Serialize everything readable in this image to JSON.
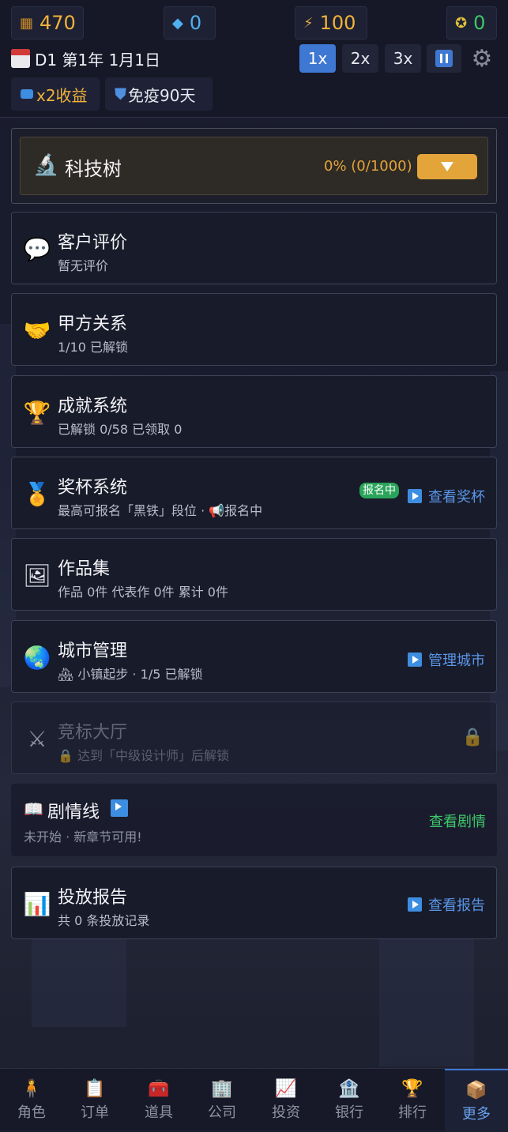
{
  "resources": [
    {
      "icon": "gold-bars-icon",
      "value": "470",
      "color": "#f2b23a"
    },
    {
      "icon": "diamond-icon",
      "value": "0",
      "color": "#4fb0f0"
    },
    {
      "icon": "energy-icon",
      "value": "100",
      "color": "#f2b23a"
    },
    {
      "icon": "token-coin-icon",
      "value": "0",
      "color": "#3ec76a"
    }
  ],
  "date": "D1 第1年 1月1日",
  "speeds": [
    "1x",
    "2x",
    "3x"
  ],
  "active_speed": "1x",
  "chips": [
    {
      "icon": "video-icon",
      "label": "x2收益",
      "color": "#f2b23a"
    },
    {
      "icon": "shield-icon",
      "label": "免疫90天",
      "color": "#f0f0f5"
    }
  ],
  "tech_tree": {
    "title": "科技树",
    "progress": "0% (0/1000)"
  },
  "cards": [
    {
      "id": "reviews",
      "icon": "speech-bubble-icon",
      "glyph": "💬",
      "title": "客户评价",
      "subtitle": "暂无评价"
    },
    {
      "id": "clients",
      "icon": "handshake-icon",
      "glyph": "🤝",
      "title": "甲方关系",
      "subtitle": "1/10 已解锁"
    },
    {
      "id": "achievements",
      "icon": "trophy-icon",
      "glyph": "🏆",
      "title": "成就系统",
      "subtitle": "已解锁 0/58  已领取 0"
    },
    {
      "id": "trophies",
      "icon": "medal-icon",
      "glyph": "🏅",
      "title": "奖杯系统",
      "subtitle": "最高可报名「黑铁」段位 · 📢报名中",
      "badge": "报名中",
      "link": "查看奖杯"
    },
    {
      "id": "portfolio",
      "icon": "picture-icon",
      "glyph": "🖼",
      "title": "作品集",
      "subtitle": "作品 0件  代表作 0件  累计 0件"
    },
    {
      "id": "city",
      "icon": "globe-icon",
      "glyph": "🌏",
      "title": "城市管理",
      "subtitle": "🏘 小镇起步 · 1/5 已解锁",
      "link": "管理城市"
    },
    {
      "id": "bidding",
      "icon": "crossed-swords-icon",
      "glyph": "⚔",
      "title": "竞标大厅",
      "subtitle": "🔒 达到「中级设计师」后解锁"
    },
    {
      "id": "story",
      "icon": "book-icon",
      "glyph": "📖",
      "title": "剧情线",
      "subtitle": "未开始 · 新章节可用!",
      "link": "查看剧情"
    },
    {
      "id": "ads",
      "icon": "bar-chart-icon",
      "glyph": "📊",
      "title": "投放报告",
      "subtitle": "共 0 条投放记录",
      "link": "查看报告"
    }
  ],
  "nav": [
    {
      "icon": "character-icon",
      "glyph": "🧍",
      "label": "角色"
    },
    {
      "icon": "clipboard-icon",
      "glyph": "📋",
      "label": "订单"
    },
    {
      "icon": "treasure-chest-icon",
      "glyph": "🧰",
      "label": "道具"
    },
    {
      "icon": "building-icon",
      "glyph": "🏢",
      "label": "公司"
    },
    {
      "icon": "chart-up-icon",
      "glyph": "📈",
      "label": "投资"
    },
    {
      "icon": "bank-icon",
      "glyph": "🏦",
      "label": "银行"
    },
    {
      "icon": "trophy-icon",
      "glyph": "🏆",
      "label": "排行"
    },
    {
      "icon": "box-icon",
      "glyph": "📦",
      "label": "更多"
    }
  ],
  "active_nav": "更多"
}
